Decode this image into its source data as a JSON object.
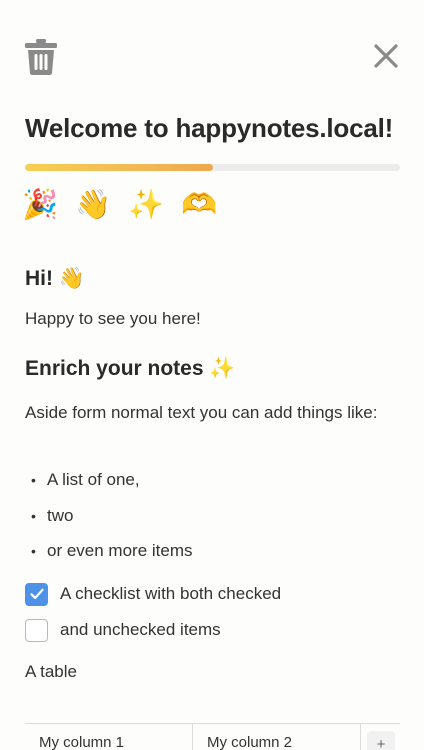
{
  "header": {
    "delete_icon": "trash-icon",
    "close_icon": "close-icon"
  },
  "title": "Welcome to happynotes.local!",
  "progress": {
    "fraction": 0.5,
    "color": "#f2b955"
  },
  "emoji_row": [
    "🎉",
    "👋",
    "✨",
    "🫶"
  ],
  "content": {
    "hi_heading": "Hi!",
    "hi_emoji": "👋",
    "intro": "Happy to see you here!",
    "enrich_heading": "Enrich your notes",
    "enrich_emoji": "✨",
    "paragraph": "Aside form normal text you can add things like:",
    "bullets": [
      "A list of one,",
      "two",
      "or even more items"
    ],
    "checklist": [
      {
        "label": "A checklist with both checked",
        "checked": true
      },
      {
        "label": "and unchecked items",
        "checked": false
      }
    ],
    "table_label": "A table",
    "table": {
      "columns": [
        "My column 1",
        "My column 2"
      ],
      "add_column_label": "+"
    }
  },
  "colors": {
    "accent": "#4d92e6",
    "progress_track": "#ececec",
    "text": "#2b2b2b",
    "icon_gray": "#8a8a8a"
  }
}
